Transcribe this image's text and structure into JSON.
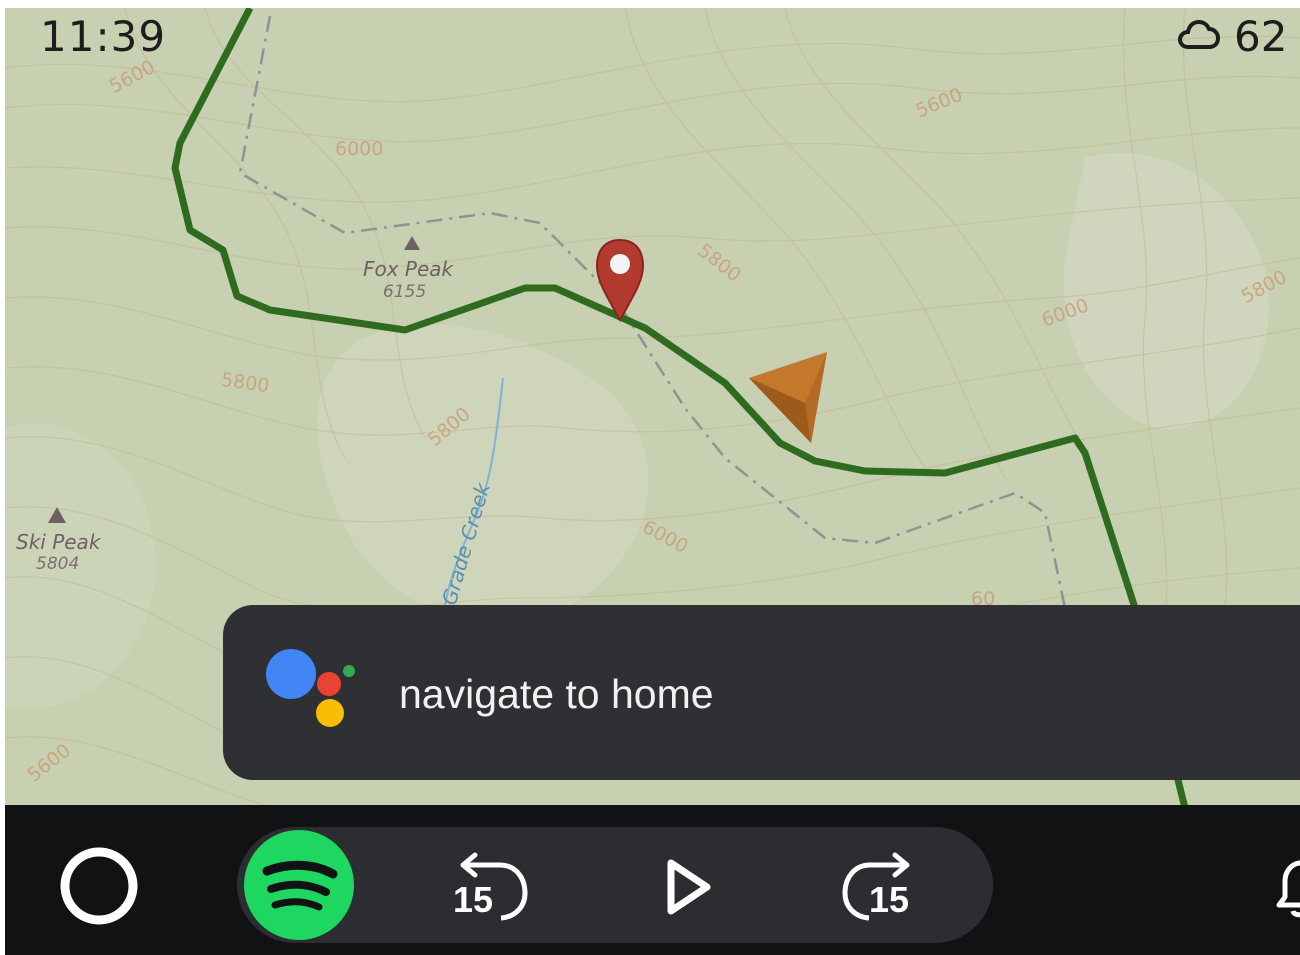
{
  "status": {
    "time": "11:39",
    "temperature": "62",
    "weather_icon": "cloud-icon"
  },
  "map": {
    "peaks": [
      {
        "name": "Fox Peak",
        "elevation": "6155"
      },
      {
        "name": "Ski Peak",
        "elevation": "5804"
      }
    ],
    "creek": "Grade Creek",
    "contours": [
      "5600",
      "6000",
      "5600",
      "5800",
      "6000",
      "5800",
      "5800",
      "5800",
      "6000",
      "5600",
      "60"
    ],
    "colors": {
      "route": "#2f6b1f",
      "pin": "#b33a2e",
      "position_arrow": "#c4782c"
    }
  },
  "assistant": {
    "query": "navigate to home",
    "icon": "google-assistant-icon"
  },
  "media": {
    "app": "Spotify",
    "app_color": "#1ed760",
    "rewind_label": "15",
    "forward_label": "15",
    "play_icon": "play-icon"
  }
}
